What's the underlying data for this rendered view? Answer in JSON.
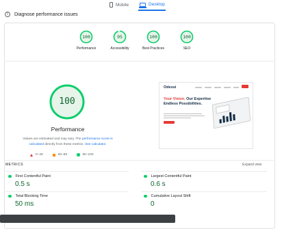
{
  "device_toggle": {
    "mobile_label": "Mobile",
    "desktop_label": "Desktop",
    "active": "Desktop"
  },
  "header": {
    "title": "Diagnose performance issues"
  },
  "scores": [
    {
      "label": "Performance",
      "value": "100"
    },
    {
      "label": "Accessibility",
      "value": "95"
    },
    {
      "label": "Best Practices",
      "value": "100"
    },
    {
      "label": "SEO",
      "value": "100"
    }
  ],
  "main_score": {
    "value": "100",
    "title": "Performance"
  },
  "note": {
    "prefix": "Values are estimated and may vary. The ",
    "link1": "performance score is calculated",
    "middle": " directly from these metrics. ",
    "link2": "See calculator."
  },
  "legend": [
    {
      "range": "0–49",
      "icon": "red-triangle-icon"
    },
    {
      "range": "50–89",
      "icon": "orange-square-icon"
    },
    {
      "range": "90–100",
      "icon": "green-circle-icon"
    }
  ],
  "thumbnail": {
    "logo": "Odessi",
    "headline_accent": "Your Vision.",
    "headline_rest": "Our Expertise Endless Possibilities."
  },
  "metrics": {
    "title": "METRICS",
    "expand_label": "Expand view",
    "items": [
      {
        "name": "First Contentful Paint",
        "value": "0.5 s"
      },
      {
        "name": "Largest Contentful Paint",
        "value": "0.6 s"
      },
      {
        "name": "Total Blocking Time",
        "value": "50 ms"
      },
      {
        "name": "Cumulative Layout Shift",
        "value": "0"
      }
    ]
  },
  "colors": {
    "pass_green": "#0cce6b",
    "pass_text": "#0d652d",
    "pass_bg": "#e6f4ea",
    "accent_blue": "#1a73e8"
  }
}
